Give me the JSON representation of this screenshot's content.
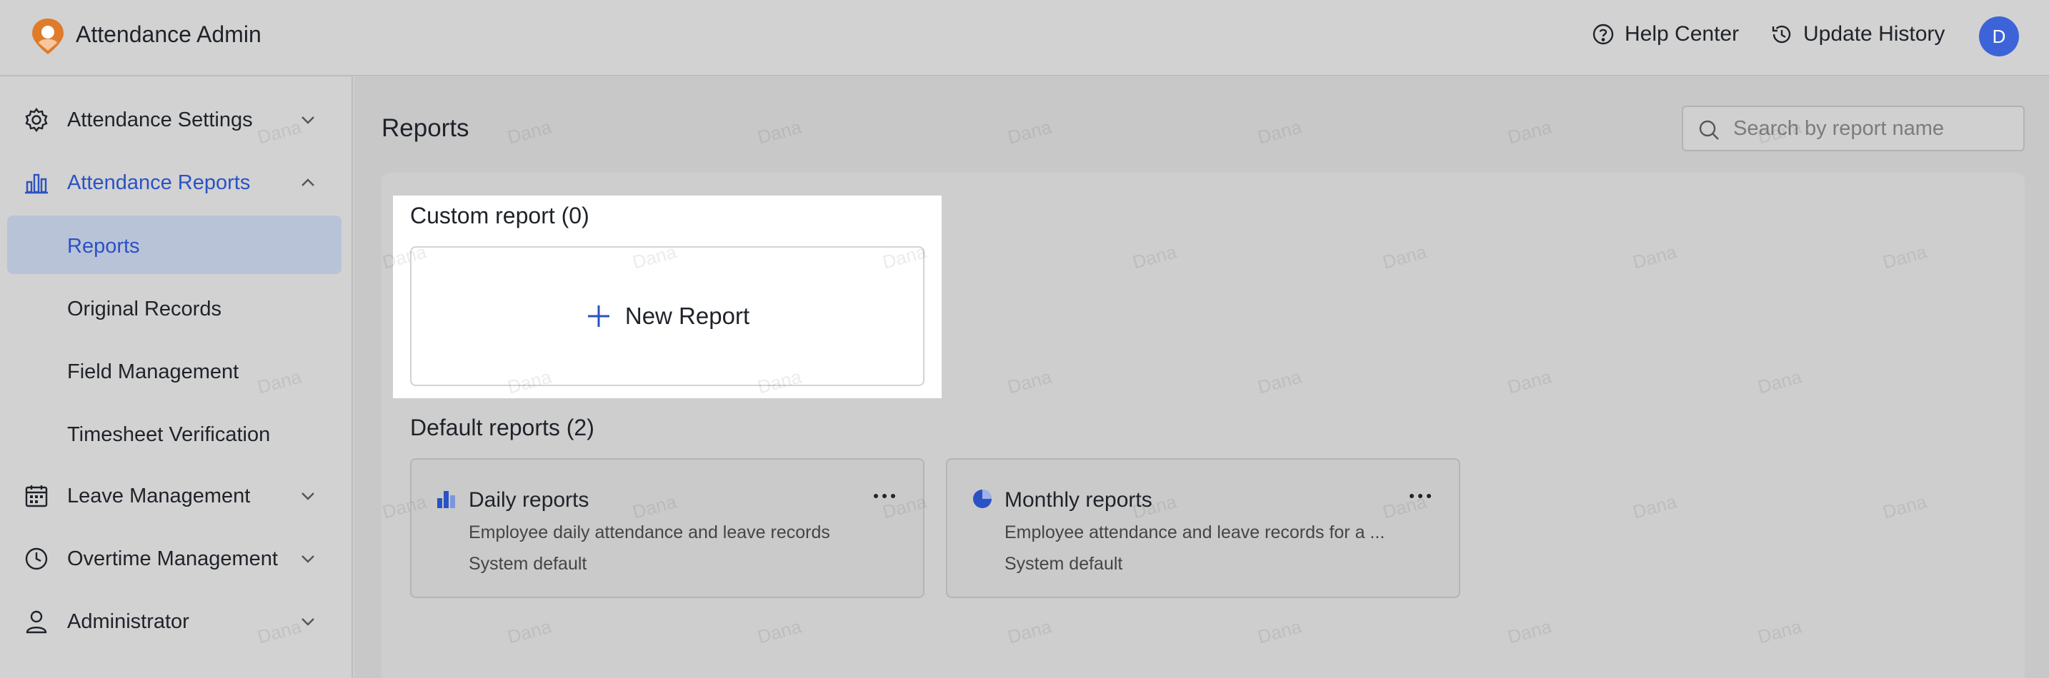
{
  "header": {
    "app_title": "Attendance Admin",
    "help_label": "Help Center",
    "history_label": "Update History",
    "avatar_initial": "D"
  },
  "sidebar": {
    "items": [
      {
        "label": "Attendance Settings",
        "icon": "gear-icon"
      },
      {
        "label": "Attendance Reports",
        "icon": "bar-chart-icon"
      },
      {
        "label": "Reports"
      },
      {
        "label": "Original Records"
      },
      {
        "label": "Field Management"
      },
      {
        "label": "Timesheet Verification"
      },
      {
        "label": "Leave Management",
        "icon": "calendar-icon"
      },
      {
        "label": "Overtime Management",
        "icon": "clock-icon"
      },
      {
        "label": "Administrator",
        "icon": "user-icon"
      }
    ]
  },
  "main": {
    "title": "Reports",
    "search_placeholder": "Search by report name",
    "custom_section_title": "Custom report (0)",
    "new_report_label": "New Report",
    "default_section_title": "Default reports (2)",
    "cards": [
      {
        "title": "Daily reports",
        "description": "Employee daily attendance and leave records",
        "subtitle": "System default",
        "icon": "bar-chart-icon"
      },
      {
        "title": "Monthly reports",
        "description": "Employee attendance and leave records for a ...",
        "subtitle": "System default",
        "icon": "pie-chart-icon"
      }
    ]
  },
  "watermark": "Dana",
  "colors": {
    "accent": "#2b52c4",
    "avatar": "#3d63d8",
    "logo": "#e07b2a",
    "active_bg": "#b9c3d8"
  }
}
